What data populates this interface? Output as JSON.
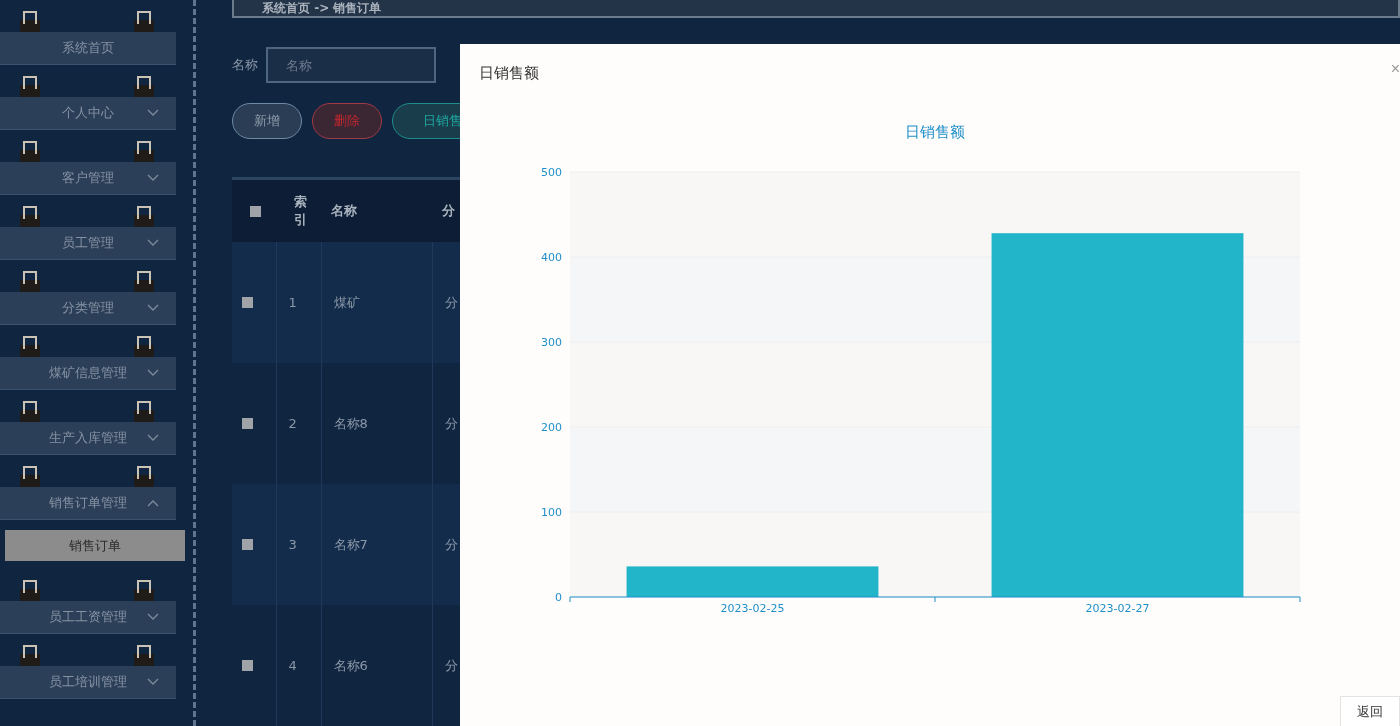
{
  "breadcrumb": "系统首页 -> 销售订单",
  "sidebar": {
    "items": [
      {
        "label": "系统首页",
        "expandable": false
      },
      {
        "label": "个人中心",
        "expandable": true,
        "expanded": false
      },
      {
        "label": "客户管理",
        "expandable": true,
        "expanded": false
      },
      {
        "label": "员工管理",
        "expandable": true,
        "expanded": false
      },
      {
        "label": "分类管理",
        "expandable": true,
        "expanded": false
      },
      {
        "label": "煤矿信息管理",
        "expandable": true,
        "expanded": false
      },
      {
        "label": "生产入库管理",
        "expandable": true,
        "expanded": false
      },
      {
        "label": "销售订单管理",
        "expandable": true,
        "expanded": true,
        "children": [
          {
            "label": "销售订单",
            "selected": true
          }
        ]
      },
      {
        "label": "员工工资管理",
        "expandable": true,
        "expanded": false
      },
      {
        "label": "员工培训管理",
        "expandable": true,
        "expanded": false
      }
    ]
  },
  "search": {
    "label": "名称",
    "placeholder": "名称"
  },
  "buttons": [
    {
      "label": "新增",
      "kind": "plain"
    },
    {
      "label": "删除",
      "kind": "danger"
    },
    {
      "label": "日销售",
      "kind": "accent"
    }
  ],
  "table": {
    "select_all": {
      "checked": false
    },
    "columns": [
      "索引",
      "名称",
      "分"
    ],
    "rows": [
      {
        "checked": false,
        "cells": [
          "1",
          "煤矿",
          "分"
        ]
      },
      {
        "checked": false,
        "cells": [
          "2",
          "名称8",
          "分"
        ]
      },
      {
        "checked": false,
        "cells": [
          "3",
          "名称7",
          "分"
        ]
      },
      {
        "checked": false,
        "cells": [
          "4",
          "名称6",
          "分"
        ]
      }
    ]
  },
  "dialog": {
    "title": "日销售额",
    "close": "×",
    "back_button": "返回",
    "chart_data": {
      "type": "bar",
      "title": "日销售额",
      "categories": [
        "2023-02-25",
        "2023-02-27"
      ],
      "series": [
        {
          "color": "#22b5c9",
          "values": [
            36,
            428
          ]
        }
      ],
      "ylim": [
        0,
        500
      ],
      "yticks": [
        0,
        100,
        200,
        300,
        400,
        500
      ]
    }
  }
}
